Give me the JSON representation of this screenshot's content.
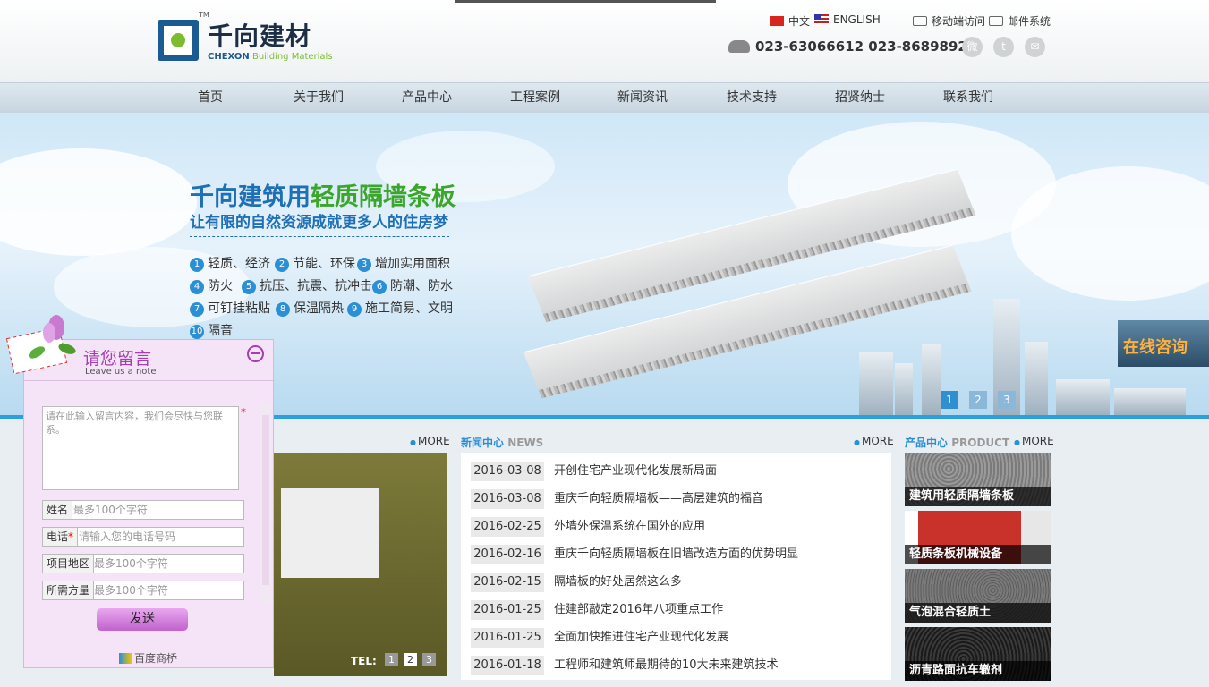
{
  "header": {
    "logo_cn": "千向建材",
    "logo_tm": "TM",
    "logo_en_main": "CHEXON",
    "logo_en_sub": "Building Materials",
    "lang_cn": "中文",
    "lang_en": "ENGLISH",
    "mobile_link": "移动端访问",
    "mail_link": "邮件系统",
    "phone": "023-63066612 023-86898927"
  },
  "nav": [
    "首页",
    "关于我们",
    "产品中心",
    "工程案例",
    "新闻资讯",
    "技术支持",
    "招贤纳士",
    "联系我们"
  ],
  "banner": {
    "title_a": "千向建筑用",
    "title_b": "轻质隔墙条板",
    "subtitle": "让有限的自然资源成就更多人的住房梦",
    "features": [
      {
        "n": "1",
        "t": "轻质、经济"
      },
      {
        "n": "2",
        "t": "节能、环保"
      },
      {
        "n": "3",
        "t": "增加实用面积"
      },
      {
        "n": "4",
        "t": "防火"
      },
      {
        "n": "5",
        "t": "抗压、抗震、抗冲击"
      },
      {
        "n": "6",
        "t": "防潮、防水"
      },
      {
        "n": "7",
        "t": "可钉挂粘贴"
      },
      {
        "n": "8",
        "t": "保温隔热"
      },
      {
        "n": "9",
        "t": "施工简易、文明"
      },
      {
        "n": "10",
        "t": "隔音"
      }
    ],
    "pager": [
      "1",
      "2",
      "3"
    ]
  },
  "online_consult": "在线咨询",
  "sections": {
    "more": "MORE",
    "news_title": "新闻中心",
    "news_title_en": "NEWS",
    "product_title": "产品中心",
    "product_title_en": "PRODUCT"
  },
  "case_pic": {
    "tel": "TEL:",
    "pager": [
      "1",
      "2",
      "3"
    ]
  },
  "news": [
    {
      "date": "2016-03-08",
      "title": "开创住宅产业现代化发展新局面"
    },
    {
      "date": "2016-03-08",
      "title": "重庆千向轻质隔墙板——高层建筑的福音"
    },
    {
      "date": "2016-02-25",
      "title": "外墙外保温系统在国外的应用"
    },
    {
      "date": "2016-02-16",
      "title": "重庆千向轻质隔墙板在旧墙改造方面的优势明显"
    },
    {
      "date": "2016-02-15",
      "title": "隔墙板的好处居然这么多"
    },
    {
      "date": "2016-01-25",
      "title": "住建部敲定2016年八项重点工作"
    },
    {
      "date": "2016-01-25",
      "title": "全面加快推进住宅产业现代化发展"
    },
    {
      "date": "2016-01-18",
      "title": "工程师和建筑师最期待的10大未来建筑技术"
    }
  ],
  "products": [
    {
      "label": "建筑用轻质隔墙条板",
      "color": "#8c8c8c"
    },
    {
      "label": "轻质条板机械设备",
      "color": "#c8322a"
    },
    {
      "label": "气泡混合轻质土",
      "color": "#6e6e6e"
    },
    {
      "label": "沥青路面抗车辙剂",
      "color": "#2a2a2a"
    }
  ],
  "form": {
    "title": "请您留言",
    "subtitle": "Leave us a note",
    "message_placeholder": "请在此输入留言内容，我们会尽快与您联系。",
    "fields": [
      {
        "label": "姓名",
        "placeholder": "最多100个字符",
        "required": false
      },
      {
        "label": "电话",
        "placeholder": "请输入您的电话号码",
        "required": true
      },
      {
        "label": "项目地区",
        "placeholder": "最多100个字符",
        "required": false
      },
      {
        "label": "所需方量",
        "placeholder": "最多100个字符",
        "required": false
      }
    ],
    "required_mark": "*",
    "send": "发送",
    "footer": "百度商桥"
  }
}
